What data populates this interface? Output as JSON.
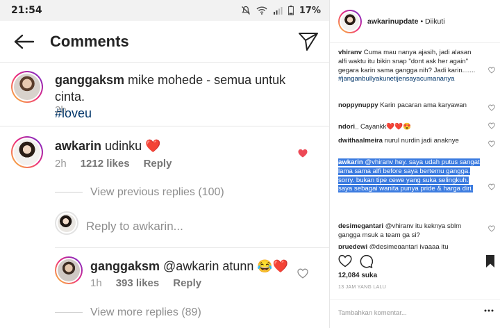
{
  "status_bar": {
    "time": "21:54",
    "battery_percent": "17%",
    "icons": [
      "mute-icon",
      "wifi-icon",
      "signal-icon",
      "battery-icon"
    ]
  },
  "app_bar": {
    "title": "Comments",
    "icons": [
      "back-arrow-icon",
      "direct-send-icon"
    ]
  },
  "caption": {
    "username": "ganggaksm",
    "text": " mike mohede - semua untuk cinta.",
    "hashtag": "#loveu",
    "time": "2h"
  },
  "top_comment": {
    "username": "awkarin",
    "text": " udinku ",
    "emoji": "❤️",
    "time": "2h",
    "likes": "1212 likes",
    "reply_label": "Reply",
    "liked": true
  },
  "view_previous": "View previous replies (100)",
  "reply_input": {
    "placeholder": "Reply to awkarin..."
  },
  "reply": {
    "username": "ganggaksm",
    "text": " @awkarin atunn ",
    "emoji": "😂❤️",
    "time": "1h",
    "likes": "393 likes",
    "reply_label": "Reply"
  },
  "view_more": "View more replies (89)",
  "desktop": {
    "username": "awkarinupdate",
    "follow_state": " • Diikuti",
    "comments": [
      {
        "user": "vhiranv",
        "text": " Cuma mau nanya ajasih, jadi alasan alfi waktu itu bikin snap \"dont ask her again\" gegara karin sama gangga nih? Jadi karin.......",
        "tag": "#janganbullyakunetijensayacumananya"
      },
      {
        "user": "noppynuppy",
        "text": " Karin pacaran ama karyawan",
        "tag": ""
      },
      {
        "user": "ndori_",
        "text": " Cayankk❤️❤️😍",
        "tag": ""
      },
      {
        "user": "dwithaalmeira",
        "text": " nurul nurdin jadi anaknye",
        "tag": ""
      },
      {
        "user": "awkarin",
        "text": " @vhiranv hey. saya udah putus sangat lama sama alfi before saya bertemu gangga. sorry. bukan tipe cewe yang suka selingkuh. saya sebagai wanita punya pride & harga diri.",
        "tag": ""
      },
      {
        "user": "desimegantari",
        "text": " @vhiranv itu keknya sblm gangga msuk a team ga si?",
        "tag": ""
      },
      {
        "user": "pruedewi",
        "text": " @desimegantari iyaaaa itu",
        "tag": ""
      }
    ],
    "likes": "12,084 suka",
    "time": "13 JAM YANG LALU",
    "add_comment_placeholder": "Tambahkan komentar..."
  },
  "colors": {
    "heart_red": "#ed4956",
    "link_blue": "#003569",
    "selection_blue": "#3b7be0",
    "muted_gray": "#8e8e8e"
  }
}
